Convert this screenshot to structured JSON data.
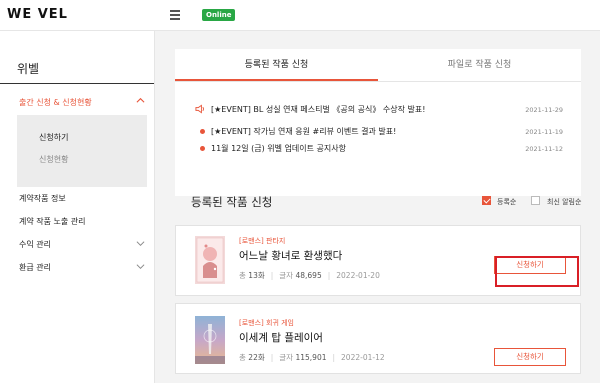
{
  "app": {
    "logo": "WE VEL",
    "status_badge": "Online"
  },
  "sidebar": {
    "title": "위벨",
    "active_menu": "출간 신청 & 신청현황",
    "submenu": [
      "신청하기",
      "신청현황"
    ],
    "items": [
      {
        "label": "계약작품 정보"
      },
      {
        "label": "계약 작품 노출 관리"
      },
      {
        "label": "수익 관리"
      },
      {
        "label": "환급 관리"
      }
    ]
  },
  "tabs": [
    {
      "label": "등록된 작품 신청",
      "active": true
    },
    {
      "label": "파일로 작품 신청",
      "active": false
    }
  ],
  "notices": [
    {
      "text": "[★EVENT] BL 성실 연재 페스티벌 《공의 공식》 수상작 발표!",
      "date": "2021-11-29",
      "icon": "speaker-icon"
    },
    {
      "text": "[★EVENT] 작가님 연재 응원 #리뷰 이벤트 결과 발표!",
      "date": "2021-11-19",
      "icon": "bullet"
    },
    {
      "text": "11월 12일 (금) 위벨 업데이트 공지사항",
      "date": "2021-11-12",
      "icon": "bullet"
    }
  ],
  "section": {
    "title": "등록된 작품 신청",
    "sort_options": [
      {
        "label": "등록순",
        "checked": true
      },
      {
        "label": "최신 알림순",
        "checked": false
      }
    ]
  },
  "works": [
    {
      "genre": "[로맨스] 판타지",
      "title": "어느날 황녀로 환생했다",
      "episodes_label": "총",
      "episodes": "13화",
      "chars_label": "글자",
      "chars": "48,695",
      "date": "2022-01-20",
      "button": "신청하기"
    },
    {
      "genre": "[로맨스] 회귀 게임",
      "title": "이세계 탑 플레이어",
      "episodes_label": "총",
      "episodes": "22화",
      "chars_label": "글자",
      "chars": "115,901",
      "date": "2022-01-12",
      "button": "신청하기"
    }
  ],
  "colors": {
    "accent": "#e8553a",
    "online": "#29a745",
    "highlight": "#d91f26"
  }
}
